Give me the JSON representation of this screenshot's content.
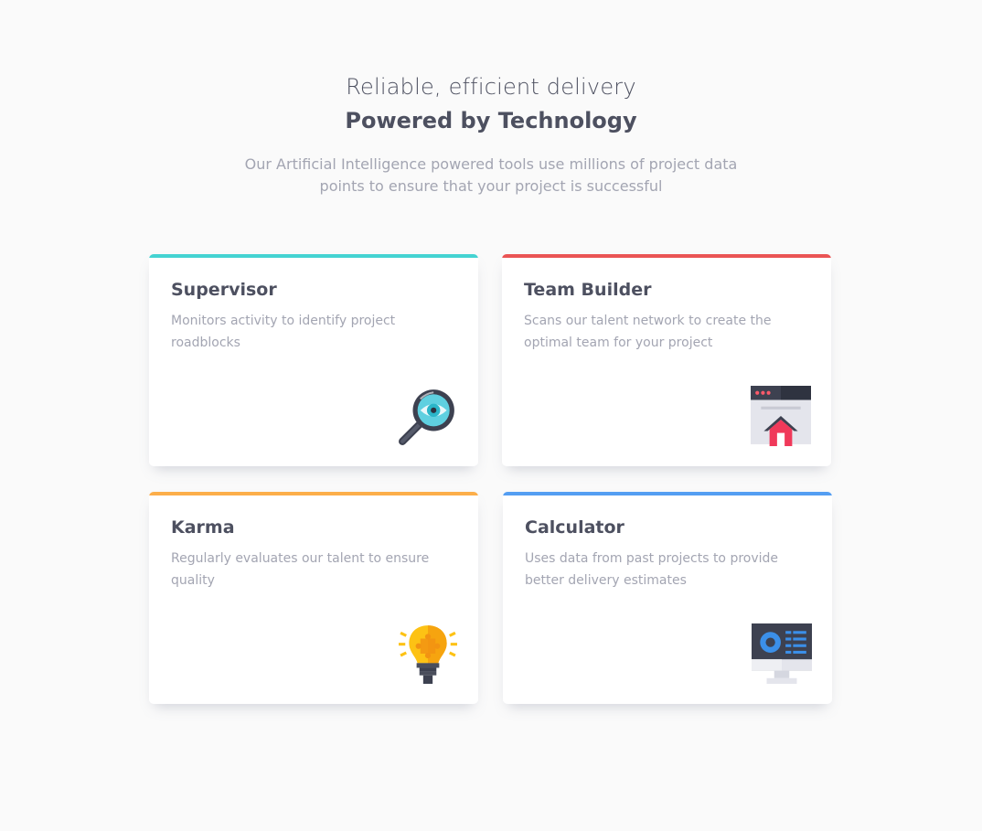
{
  "header": {
    "subtitle": "Reliable, efficient delivery",
    "title": "Powered by Technology",
    "intro": "Our Artificial Intelligence powered tools use millions of project data points to ensure that your project is successful"
  },
  "cards": [
    {
      "title": "Supervisor",
      "description": "Monitors activity to identify project roadblocks",
      "accent": "#44d3d2",
      "icon": "magnifier-eye-icon"
    },
    {
      "title": "Team Builder",
      "description": "Scans our talent network to create the optimal team for your project",
      "accent": "#ea5454",
      "icon": "browser-home-icon"
    },
    {
      "title": "Karma",
      "description": "Regularly evaluates our talent to ensure quality",
      "accent": "#fcae4a",
      "icon": "lightbulb-icon"
    },
    {
      "title": "Calculator",
      "description": "Uses data from past projects to provide better delivery estimates",
      "accent": "#549ef2",
      "icon": "monitor-dashboard-icon"
    }
  ]
}
